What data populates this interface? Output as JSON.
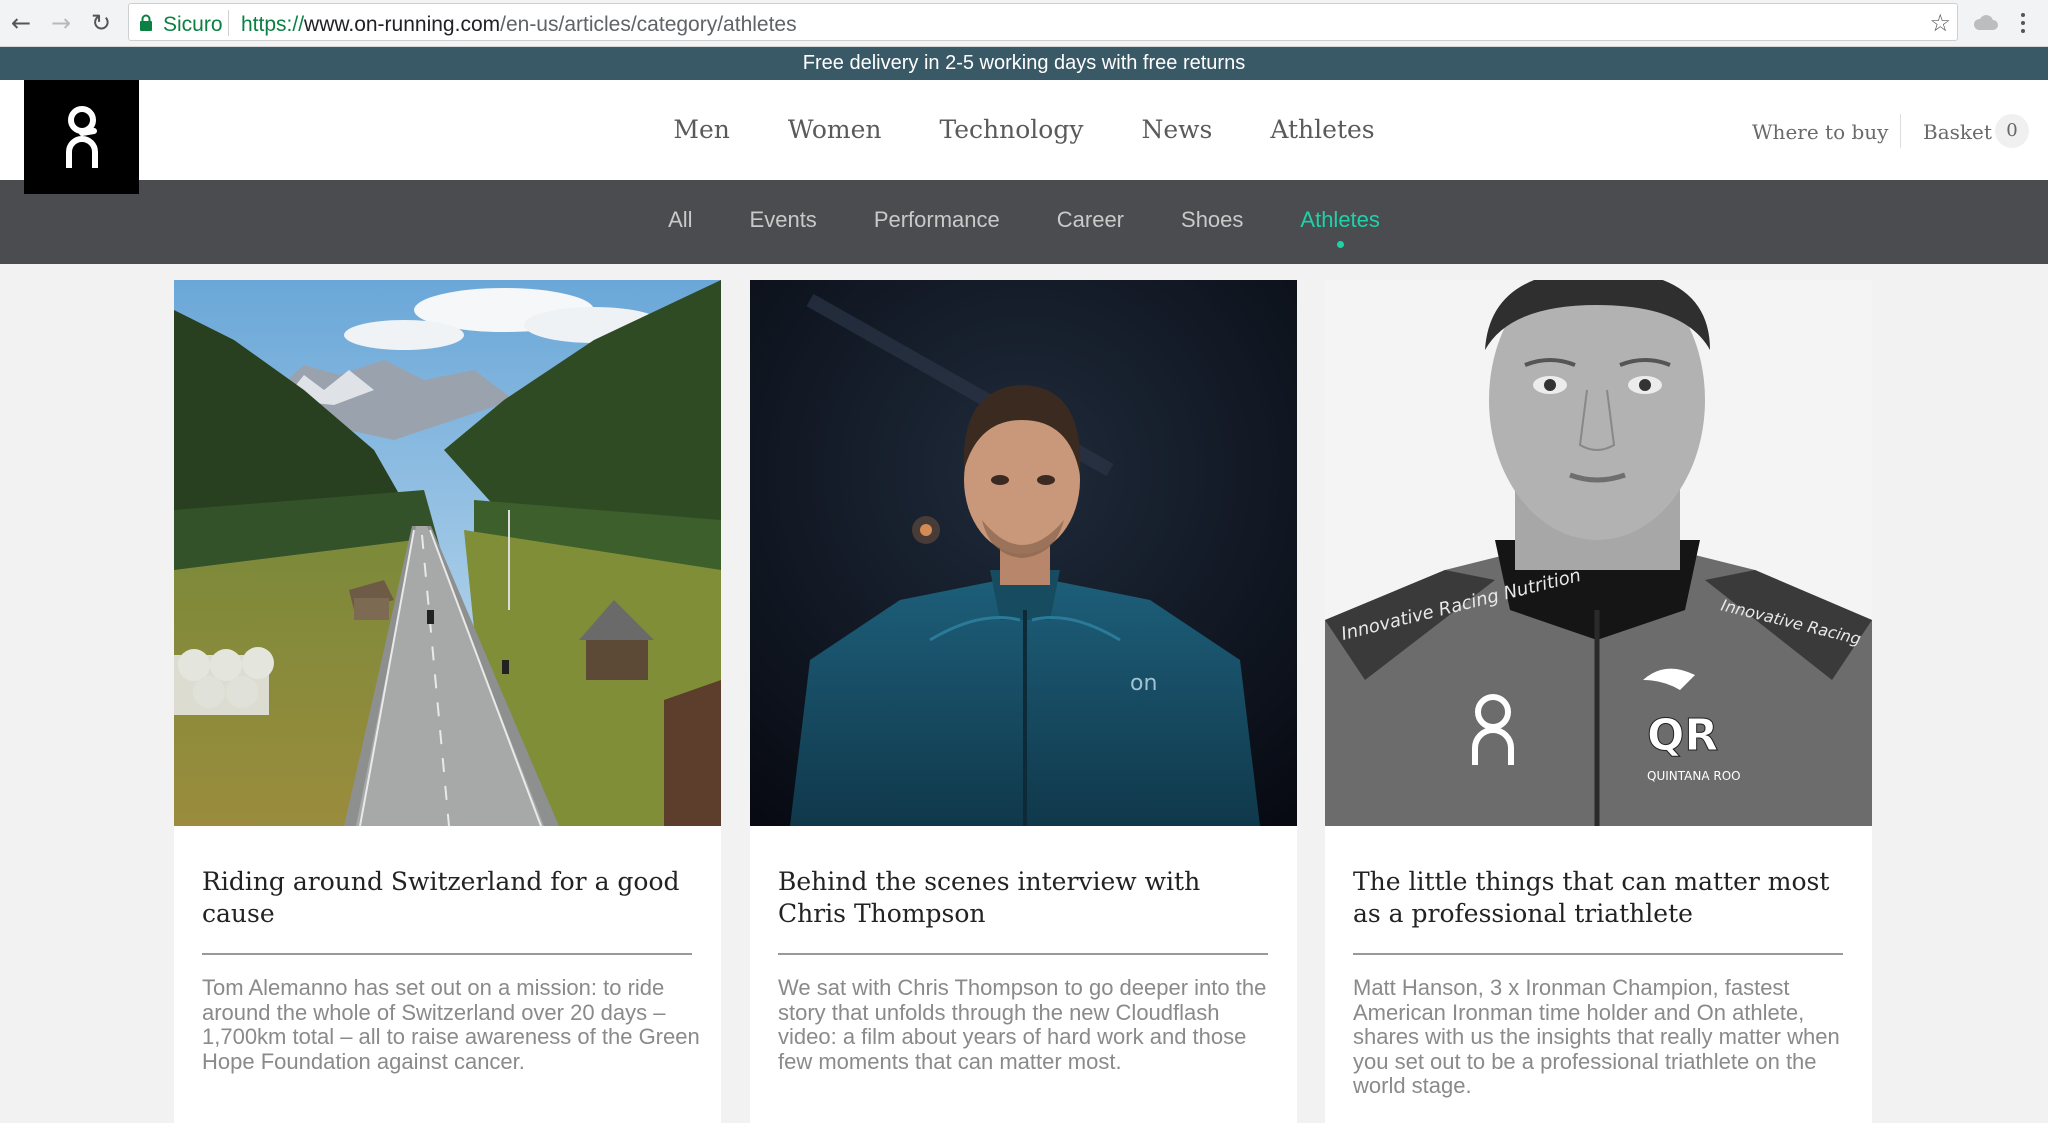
{
  "browser": {
    "secure_label": "Sicuro",
    "url_scheme": "https://",
    "url_host": "www.on-running.com",
    "url_path": "/en-us/articles/category/athletes"
  },
  "promo": {
    "text": "Free delivery in 2-5 working days with free returns"
  },
  "header": {
    "nav": [
      "Men",
      "Women",
      "Technology",
      "News",
      "Athletes"
    ],
    "where_to_buy": "Where to buy",
    "basket_label": "Basket",
    "basket_count": "0"
  },
  "subnav": {
    "items": [
      "All",
      "Events",
      "Performance",
      "Career",
      "Shoes",
      "Athletes"
    ],
    "active": "Athletes"
  },
  "articles": [
    {
      "title": "Riding around Switzerland for a good cause",
      "excerpt": "Tom Alemanno has set out on a mission: to ride around the whole of Switzerland over 20 days – 1,700km total – all to raise awareness of the Green Hope Foundation against cancer."
    },
    {
      "title": "Behind the scenes interview with Chris Thompson",
      "excerpt": "We sat with Chris Thompson to go deeper into the story that unfolds through the new Cloudflash video: a film about years of hard work and those few moments that can matter most."
    },
    {
      "title": "The little things that can matter most as a professional triathlete",
      "excerpt": "Matt Hanson, 3 x Ironman Champion, fastest American Ironman time holder and On athlete, shares with us the insights that really matter when you set out to be a professional triathlete on the world stage."
    }
  ],
  "colors": {
    "promo_bg": "#3a5966",
    "subnav_bg": "#4a4c4f",
    "accent": "#1ed2a8"
  }
}
